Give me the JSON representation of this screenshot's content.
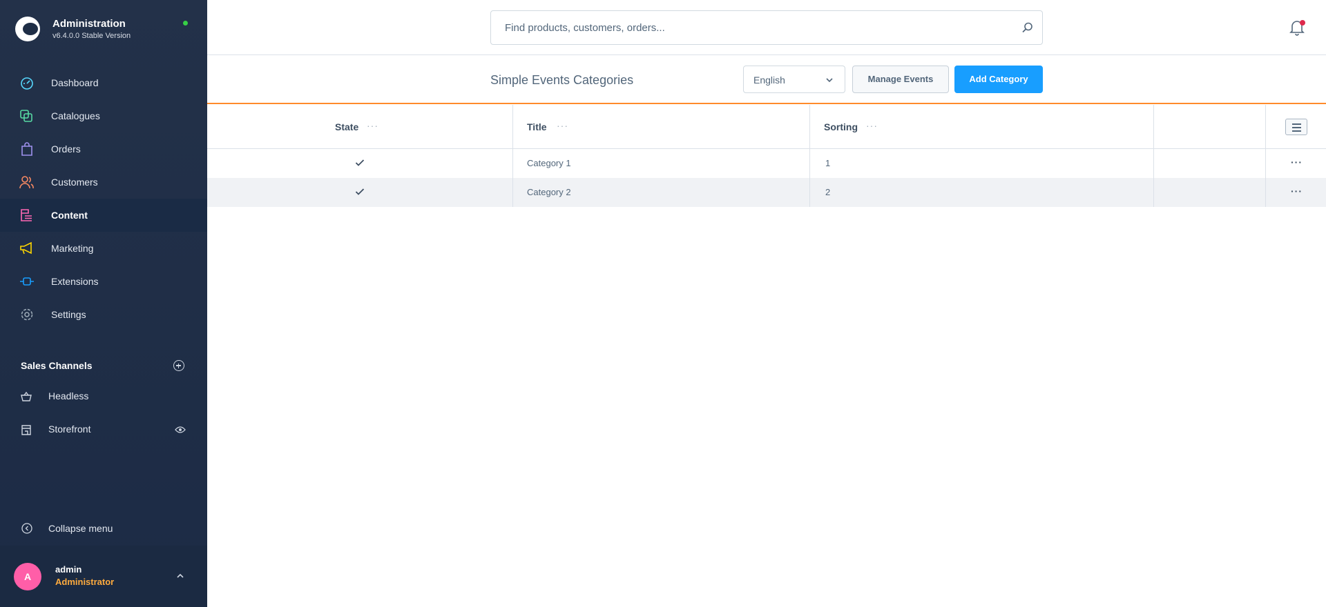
{
  "brand": {
    "title": "Administration",
    "version": "v6.4.0.0 Stable Version"
  },
  "nav": [
    {
      "label": "Dashboard",
      "icon": "dashboard-icon",
      "color": "#57d9ff"
    },
    {
      "label": "Catalogues",
      "icon": "catalogues-icon",
      "color": "#57d9a3"
    },
    {
      "label": "Orders",
      "icon": "orders-icon",
      "color": "#a092f0"
    },
    {
      "label": "Customers",
      "icon": "customers-icon",
      "color": "#f88962"
    },
    {
      "label": "Content",
      "icon": "content-icon",
      "color": "#ff68b4",
      "active": true
    },
    {
      "label": "Marketing",
      "icon": "marketing-icon",
      "color": "#ffd700"
    },
    {
      "label": "Extensions",
      "icon": "extensions-icon",
      "color": "#189eff"
    },
    {
      "label": "Settings",
      "icon": "settings-icon",
      "color": "#9aa8b5"
    }
  ],
  "sales_channels": {
    "title": "Sales Channels",
    "items": [
      {
        "label": "Headless",
        "icon": "basket-icon"
      },
      {
        "label": "Storefront",
        "icon": "storefront-icon"
      }
    ]
  },
  "collapse_label": "Collapse menu",
  "user": {
    "initial": "A",
    "name": "admin",
    "role": "Administrator"
  },
  "search": {
    "placeholder": "Find products, customers, orders..."
  },
  "smartbar": {
    "title": "Simple Events Categories",
    "language": "English",
    "manage_label": "Manage Events",
    "add_label": "Add Category"
  },
  "table": {
    "columns": {
      "state": "State",
      "title": "Title",
      "sorting": "Sorting"
    },
    "column_menu": "···",
    "row_menu": "···",
    "rows": [
      {
        "state": true,
        "title": "Category 1",
        "sorting": "1"
      },
      {
        "state": true,
        "title": "Category 2",
        "sorting": "2"
      }
    ]
  },
  "colors": {
    "accent": "#189eff",
    "smartbar_border": "#ff8b2b",
    "sidebar": "#1f2e46",
    "role": "#ffab3e",
    "avatar": "#ff5ea8",
    "online": "#37d046"
  }
}
